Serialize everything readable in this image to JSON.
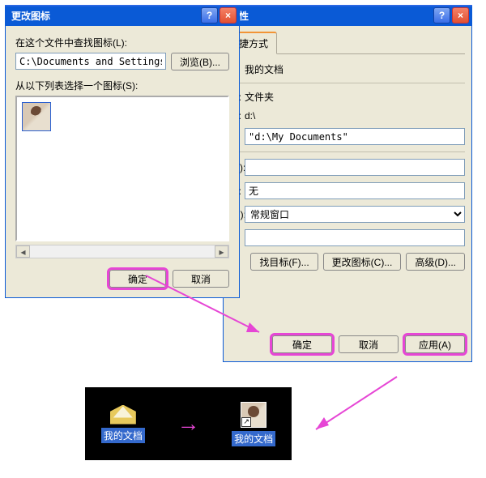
{
  "change_icon_dialog": {
    "title": "更改图标",
    "label_search_in": "在这个文件中查找图标(L):",
    "path_value": "C:\\Documents and Settings\\Admi",
    "browse_btn": "浏览(B)...",
    "label_select": "从以下列表选择一个图标(S):",
    "ok_btn": "确定",
    "cancel_btn": "取消"
  },
  "properties_dialog": {
    "title": "属性",
    "tab_shortcut": "捷方式",
    "name_value": "我的文档",
    "type_label": ":",
    "type_value": "文件夹",
    "location_label": ":",
    "location_value": "d:\\",
    "target_value": "\"d:\\My Documents\"",
    "row_s_label": "(S):",
    "row_k_label": "):",
    "shortcut_key_value": "无",
    "row_r_label": "(R):",
    "run_value": "常规窗口",
    "find_target_btn": "找目标(F)...",
    "change_icon_btn": "更改图标(C)...",
    "advanced_btn": "高级(D)...",
    "ok_btn": "确定",
    "cancel_btn": "取消",
    "apply_btn": "应用(A)"
  },
  "desktop_demo": {
    "before_caption": "我的文档",
    "after_caption": "我的文档"
  }
}
